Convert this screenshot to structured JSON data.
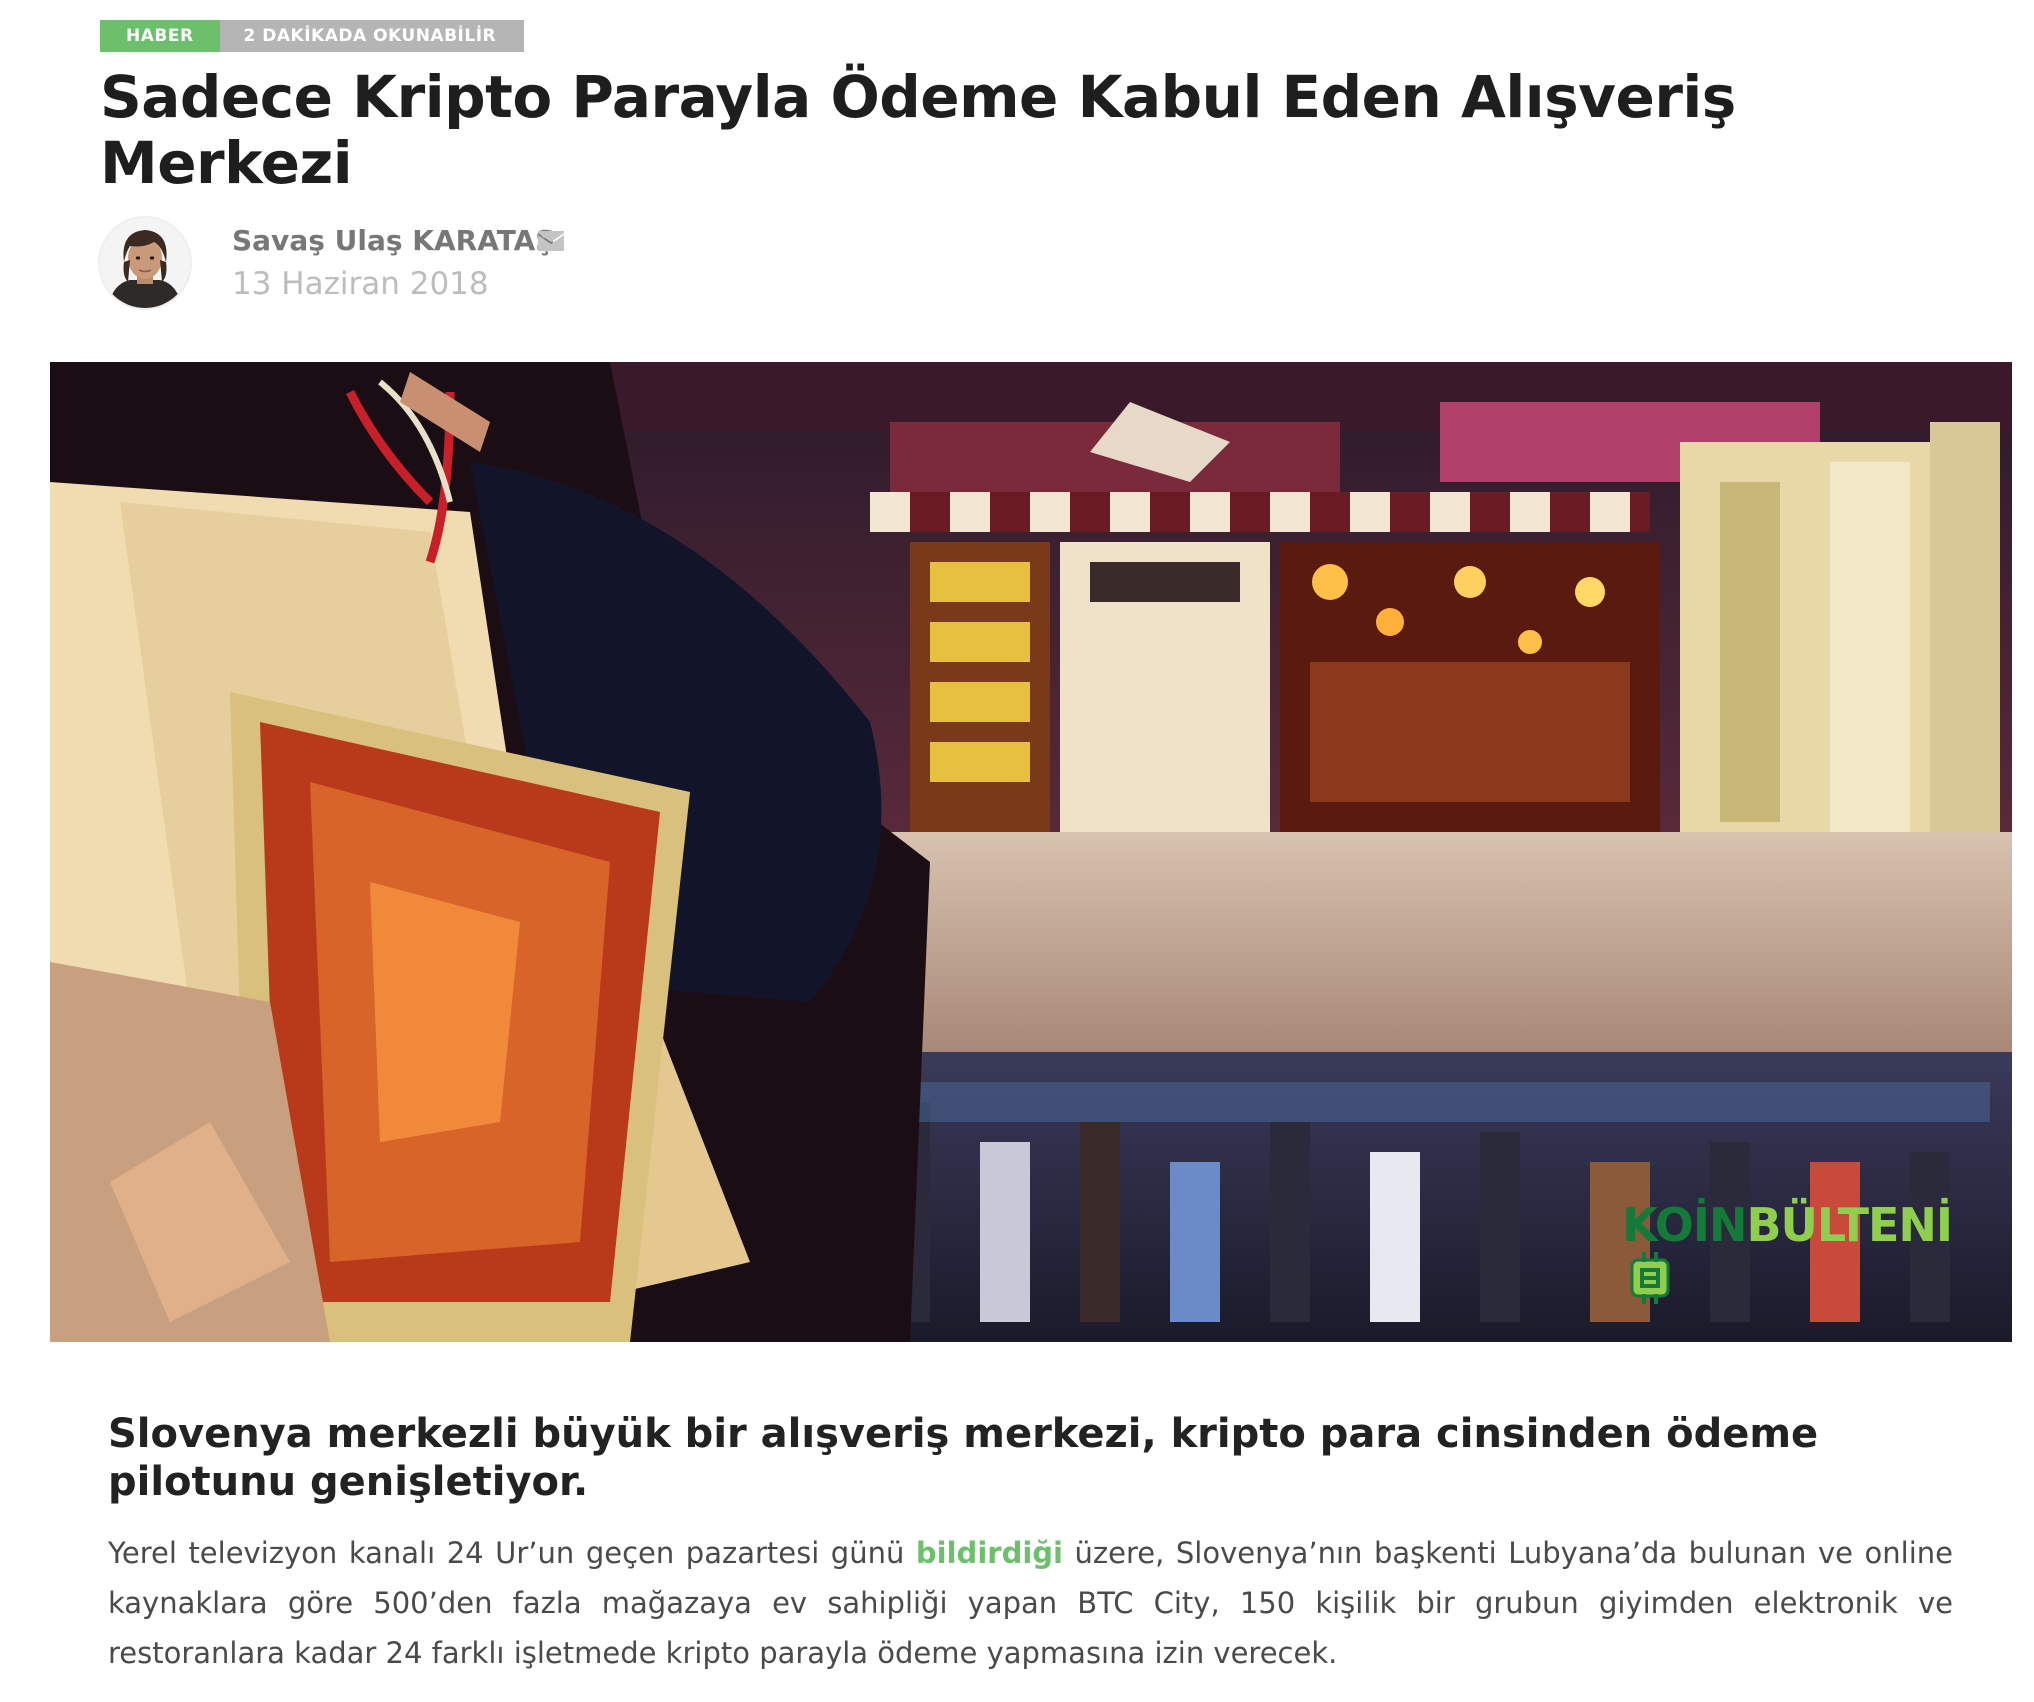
{
  "article": {
    "category_tag": "HABER",
    "reading_time_tag": "2 DAKİKADA OKUNABİLİR",
    "title": "Sadece Kripto Parayla Ödeme Kabul Eden Alışveriş Merkezi",
    "author_name": "Savaş Ulaş KARATAŞ",
    "date": "13 Haziran 2018",
    "lead": "Slovenya merkezli büyük bir alışveriş merkezi, kripto para cinsinden ödeme pilotunu genişletiyor.",
    "body_part1": "Yerel televizyon kanalı 24 Ur’un geçen pazartesi günü ",
    "body_link": "bildirdiği",
    "body_part2": " üzere, Slovenya’nın başkenti Lubyana’da bulunan ve online kaynaklara göre 500’den fazla mağazaya ev sahipliği yapan BTC City, 150 kişilik bir grubun giyimden elektronik ve restoranlara kadar 24 farklı işletmede kripto parayla ödeme yapmasına izin verecek."
  },
  "hero_image": {
    "watermark_part1": "KOİN",
    "watermark_part2": "BÜLTENİ"
  },
  "icons": {
    "mail": "envelope-icon",
    "watermark_logo": "coin-chip-icon"
  },
  "colors": {
    "accent_green": "#6cc06b",
    "tag_gray": "#b5b5b5",
    "title": "#1e1e1e",
    "author": "#777777",
    "date": "#bdbdbd",
    "body": "#4a4a4a"
  }
}
